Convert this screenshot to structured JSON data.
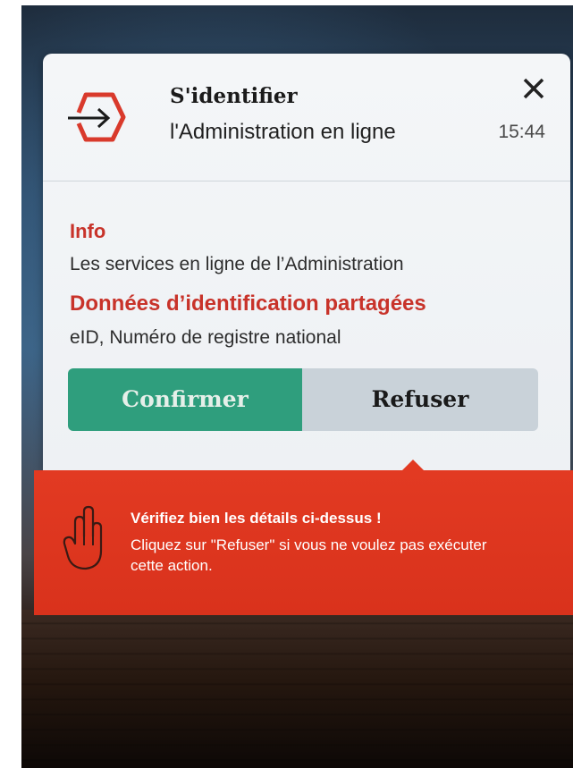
{
  "dialog": {
    "title": "S'identifier",
    "subtitle": "l'Administration en ligne",
    "time": "15:44",
    "close_icon": "close-icon",
    "logo_icon": "login-arrow-hexagon-icon"
  },
  "details": {
    "info_title": "Info",
    "info_text": "Les services en ligne de l’Administration",
    "data_title": "Données d’identification partagées",
    "data_text": "eID, Numéro de registre national"
  },
  "actions": {
    "confirm_label": "Confirmer",
    "refuse_label": "Refuser"
  },
  "warning": {
    "icon": "hand-pointing-icon",
    "title": "Vérifiez bien les détails ci-dessus !",
    "text": "Cliquez sur \"Refuser\" si vous ne voulez pas exécuter cette action."
  },
  "colors": {
    "accent_red": "#c8332a",
    "confirm_green": "#2f9e7d",
    "refuse_gray": "#c9d2d9",
    "banner_red": "#e23a22"
  }
}
